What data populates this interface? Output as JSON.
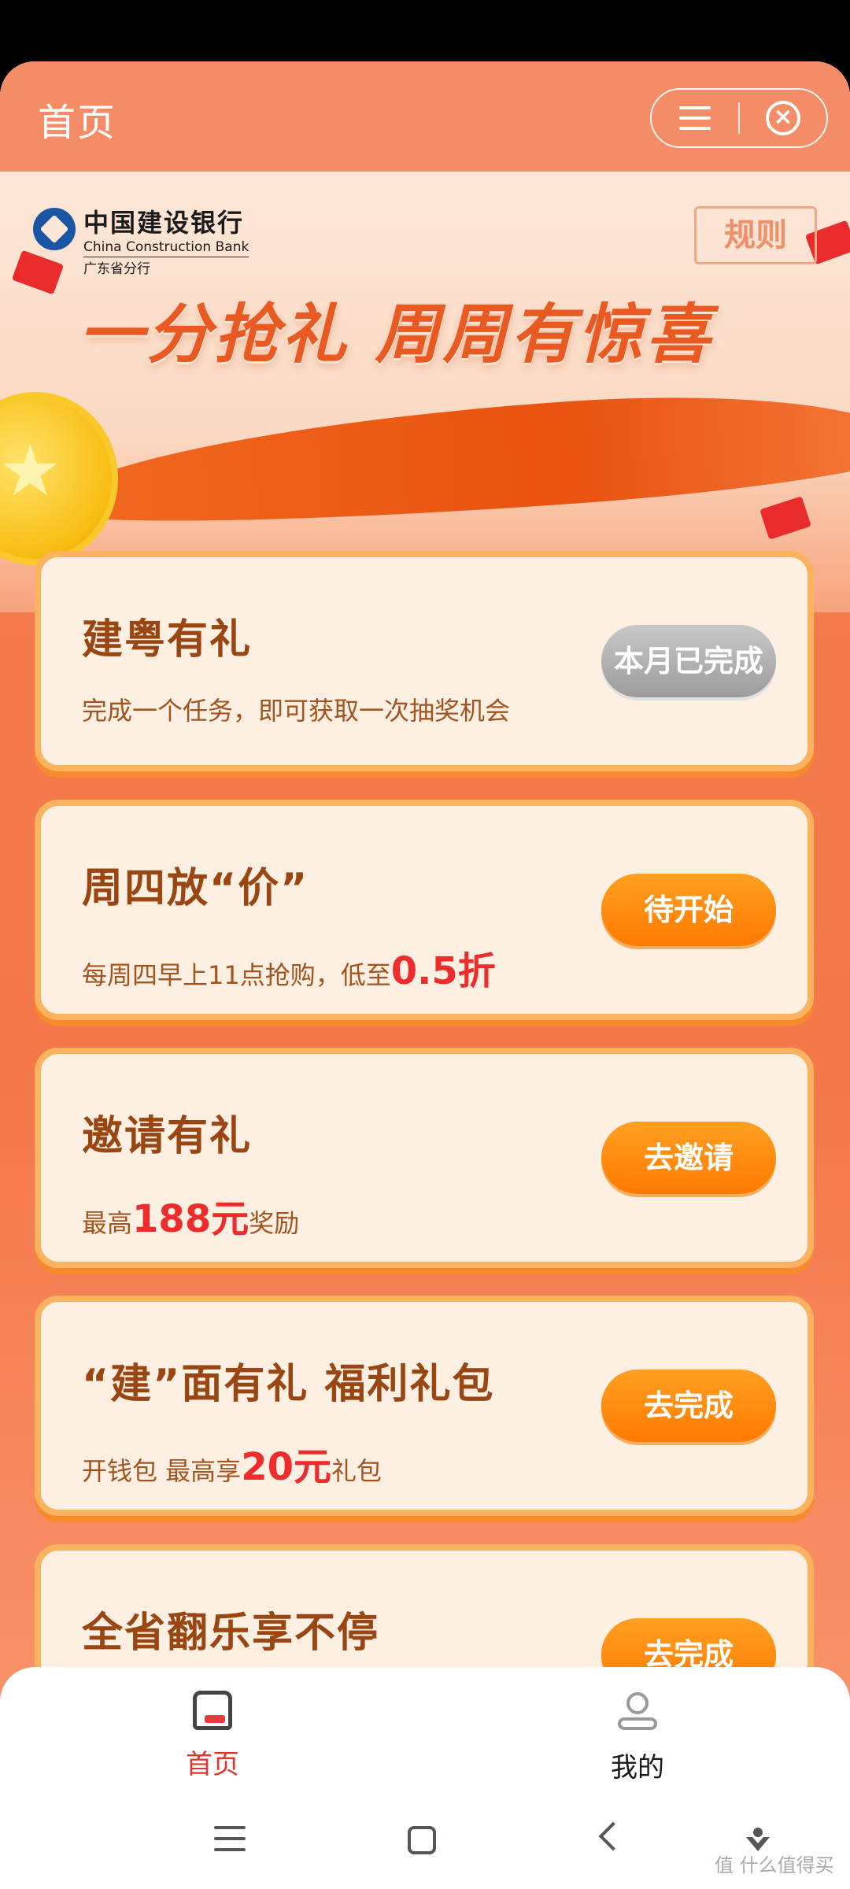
{
  "header": {
    "title": "首页",
    "menu_icon": "menu-icon",
    "close_icon": "close-circle-icon"
  },
  "banner": {
    "bank_name_cn": "中国建设银行",
    "bank_name_en": "China Construction Bank",
    "branch": "广东省分行",
    "rules_label": "规则",
    "slogan": "一分抢礼  周周有惊喜"
  },
  "cards": [
    {
      "title": "建粤有礼",
      "desc_pre": "完成一个任务，即可获取一次抽奖机会",
      "desc_hl": "",
      "desc_post": "",
      "button": "本月已完成",
      "button_state": "done"
    },
    {
      "title": "周四放“价”",
      "desc_pre": "每周四早上11点抢购，低至",
      "desc_hl": "0.5折",
      "desc_post": "",
      "button": "待开始",
      "button_state": "active"
    },
    {
      "title": "邀请有礼",
      "desc_pre": "最高",
      "desc_hl": "188元",
      "desc_post": "奖励",
      "button": "去邀请",
      "button_state": "active"
    },
    {
      "title": "“建”面有礼 福利礼包",
      "desc_pre": "开钱包 最高享",
      "desc_hl": "20元",
      "desc_post": "礼包",
      "button": "去完成",
      "button_state": "active"
    },
    {
      "title": "全省翻乐享不停",
      "desc_pre": "",
      "desc_hl": "",
      "desc_post": "",
      "button": "去完成",
      "button_state": "active"
    }
  ],
  "tabbar": {
    "home_label": "首页",
    "mine_label": "我的",
    "home_icon": "home-icon",
    "mine_icon": "user-icon",
    "active_color": "#e0342c"
  },
  "watermark": "值 什么值得买",
  "colors": {
    "accent": "#ff7a00",
    "title_brown": "#9a4613",
    "highlight_red": "#ef2c2c"
  }
}
